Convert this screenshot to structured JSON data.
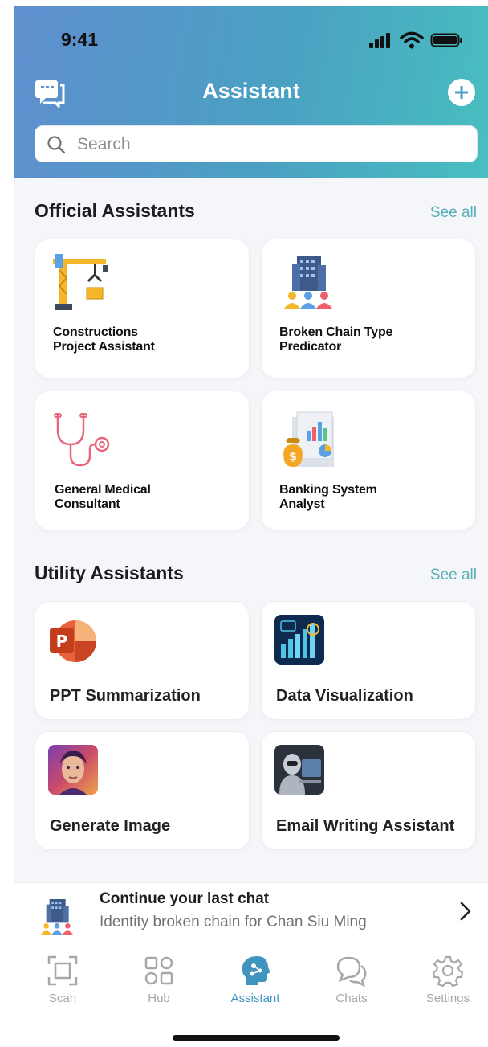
{
  "status": {
    "time": "9:41"
  },
  "header": {
    "title": "Assistant"
  },
  "search": {
    "placeholder": "Search"
  },
  "official": {
    "title": "Official Assistants",
    "see_all": "See all",
    "items": [
      {
        "label": "Constructions\nProject Assistant",
        "icon": "crane-icon"
      },
      {
        "label": "Broken Chain Type\nPredicator",
        "icon": "building-people-icon"
      },
      {
        "label": "General Medical\nConsultant",
        "icon": "stethoscope-icon"
      },
      {
        "label": "Banking System\nAnalyst",
        "icon": "money-chart-icon"
      }
    ]
  },
  "utility": {
    "title": "Utility Assistants",
    "see_all": "See all",
    "items": [
      {
        "label": "PPT Summarization",
        "icon": "powerpoint-icon"
      },
      {
        "label": "Data Visualization",
        "icon": "data-chart-icon"
      },
      {
        "label": "Generate Image",
        "icon": "ai-face-icon"
      },
      {
        "label": "Email Writing Assistant",
        "icon": "robot-icon"
      }
    ]
  },
  "continue_chat": {
    "title": "Continue your last chat",
    "subtitle": "Identity broken chain for Chan Siu Ming"
  },
  "tabs": [
    {
      "label": "Scan",
      "icon": "scan-icon",
      "active": false
    },
    {
      "label": "Hub",
      "icon": "grid-icon",
      "active": false
    },
    {
      "label": "Assistant",
      "icon": "assistant-head-icon",
      "active": true
    },
    {
      "label": "Chats",
      "icon": "chat-bubbles-icon",
      "active": false
    },
    {
      "label": "Settings",
      "icon": "gear-icon",
      "active": false
    }
  ],
  "colors": {
    "accent": "#3f94c0",
    "link": "#5aaeb9",
    "header_start": "#5f8fcf",
    "header_end": "#48bfc0"
  }
}
